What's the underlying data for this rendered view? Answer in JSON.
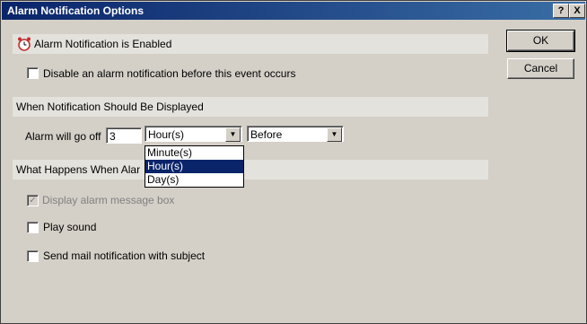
{
  "window": {
    "title": "Alarm Notification Options",
    "help_glyph": "?",
    "close_glyph": "X"
  },
  "section_enabled": {
    "label": "Alarm Notification is Enabled"
  },
  "disable_before": {
    "label": "Disable an alarm notification before this event occurs",
    "checked": false
  },
  "section_when": {
    "label": "When Notification Should Be Displayed"
  },
  "alarm_off": {
    "label": "Alarm will go off",
    "amount": "3",
    "unit_selected": "Hour(s)",
    "relation_selected": "Before",
    "unit_options": [
      "Minute(s)",
      "Hour(s)",
      "Day(s)"
    ]
  },
  "section_what": {
    "label": "What Happens When Alar"
  },
  "options": {
    "display_box": {
      "label": "Display alarm message box",
      "checked": true,
      "enabled": false
    },
    "play_sound": {
      "label": "Play sound",
      "checked": false
    },
    "send_mail": {
      "label": "Send mail notification with subject",
      "checked": false
    }
  },
  "buttons": {
    "ok": "OK",
    "cancel": "Cancel"
  },
  "check_glyph": "✓",
  "arrow_glyph": "▼"
}
